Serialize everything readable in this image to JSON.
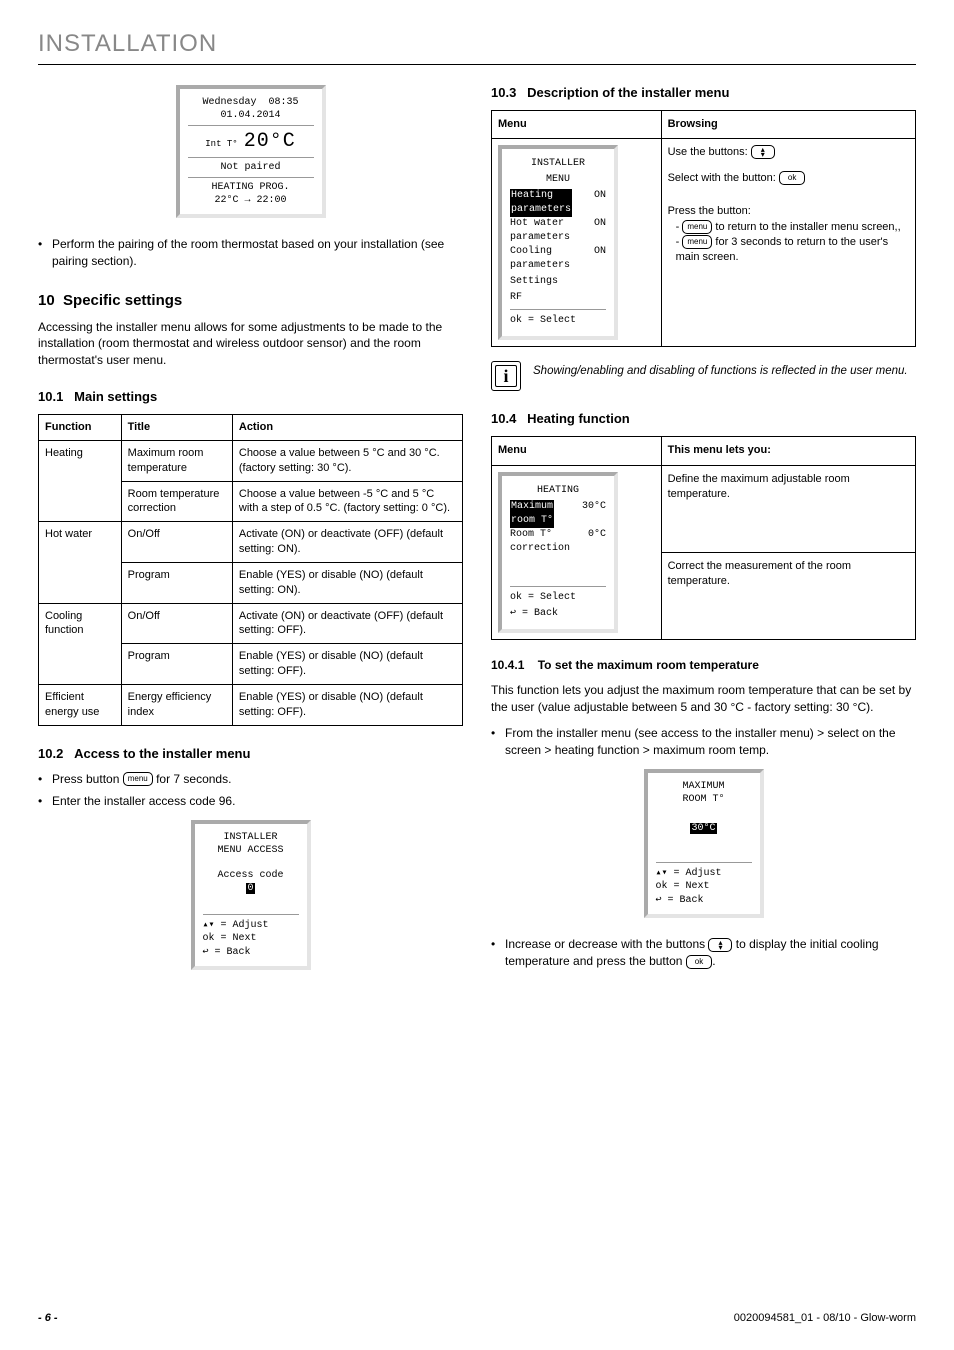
{
  "header": "INSTALLATION",
  "lcd_main": {
    "day": "Wednesday",
    "time": "08:35",
    "date": "01.04.2014",
    "int_label": "Int T°",
    "temp": "20°C",
    "not_paired": "Not paired",
    "prog_label": "HEATING PROG.",
    "prog_value": "22°C → 22:00"
  },
  "pairing_note": "Perform the pairing of the room thermostat based on your installation (see pairing section).",
  "sec10": {
    "num": "10",
    "title": "Specific settings"
  },
  "sec10_intro": "Accessing the installer menu allows for some adjustments to be made to the installation (room thermostat and wireless outdoor sensor) and the room thermostat's user menu.",
  "sec10_1": {
    "num": "10.1",
    "title": "Main settings"
  },
  "main_tbl": {
    "headers": [
      "Function",
      "Title",
      "Action"
    ],
    "rows": [
      [
        "Heating",
        "Maximum room temperature",
        "Choose a value between 5 °C and 30 °C. (factory setting: 30 °C)."
      ],
      [
        "",
        "Room temperature correction",
        "Choose a value between -5 °C and 5 °C with a step of 0.5 °C. (factory setting: 0 °C)."
      ],
      [
        "Hot water",
        "On/Off",
        "Activate (ON) or deactivate (OFF) (default setting: ON)."
      ],
      [
        "",
        "Program",
        "Enable (YES) or disable (NO) (default setting: ON)."
      ],
      [
        "Cooling function",
        "On/Off",
        "Activate (ON) or deactivate (OFF) (default setting: OFF)."
      ],
      [
        "",
        "Program",
        "Enable (YES) or disable (NO) (default setting: OFF)."
      ],
      [
        "Efficient energy use",
        "Energy efficiency index",
        "Enable (YES) or disable (NO) (default setting: OFF)."
      ]
    ]
  },
  "sec10_2": {
    "num": "10.2",
    "title": "Access to the installer menu"
  },
  "access_b1_pre": "Press button ",
  "access_b1_post": " for 7 seconds.",
  "access_b2": "Enter the installer access code 96.",
  "lcd_access": {
    "title1": "INSTALLER",
    "title2": "MENU ACCESS",
    "label": "Access code",
    "value": "0",
    "h1": "▴▾  = Adjust",
    "h2": "ok  = Next",
    "h3": "↩   = Back"
  },
  "sec10_3": {
    "num": "10.3",
    "title": "Description of the installer menu"
  },
  "tbl103_h1": "Menu",
  "tbl103_h2": "Browsing",
  "lcd_installer": {
    "title1": "INSTALLER",
    "title2": "MENU",
    "r1": "Heating parameters",
    "v1": "ON",
    "r2": "Hot water parameters",
    "v2": "ON",
    "r3": "Cooling parameters",
    "v3": "ON",
    "r4": "Settings",
    "r5": "RF",
    "hint": "ok  = Select"
  },
  "browse_l1": "Use the buttons:",
  "browse_l2": "Select with the button:",
  "browse_l3": "Press the button:",
  "browse_l4a": " to return to the installer menu screen,,",
  "browse_l4b": " for 3 seconds to return to the user's main screen.",
  "info_text": "Showing/enabling and disabling of functions is reflected in the user menu.",
  "sec10_4": {
    "num": "10.4",
    "title": "Heating function"
  },
  "tbl104_h1": "Menu",
  "tbl104_h2": "This menu lets you:",
  "lcd_heating": {
    "title": "HEATING",
    "r1": "Maximum room T°",
    "v1": "30°C",
    "r2": "Room T° correction",
    "v2": "0°C",
    "h1": "ok  = Select",
    "h2": "↩   = Back"
  },
  "tbl104_r1": "Define the maximum adjustable room temperature.",
  "tbl104_r2": "Correct the measurement of the room temperature.",
  "sec10_4_1": {
    "num": "10.4.1",
    "title": "To set the maximum room temperature"
  },
  "p1041": "This function lets you adjust the maximum room temperature that can be set by the user (value adjustable between 5 and 30 °C - factory setting: 30 °C).",
  "b1041": "From the installer menu (see access to the installer menu) > select on the screen > heating function > maximum room temp.",
  "lcd_max": {
    "title1": "MAXIMUM",
    "title2": "ROOM T°",
    "value": "30°C",
    "h1": "▴▾  = Adjust",
    "h2": "ok  = Next",
    "h3": "↩   = Back"
  },
  "b1041b_pre": "Increase or decrease with the buttons ",
  "b1041b_mid": " to display the initial cooling temperature and press the button ",
  "b1041b_post": ".",
  "menu_label": "menu",
  "ok_label": "ok",
  "footer": {
    "page": "- 6 -",
    "ref": "0020094581_01 - 08/10 - Glow-worm"
  }
}
